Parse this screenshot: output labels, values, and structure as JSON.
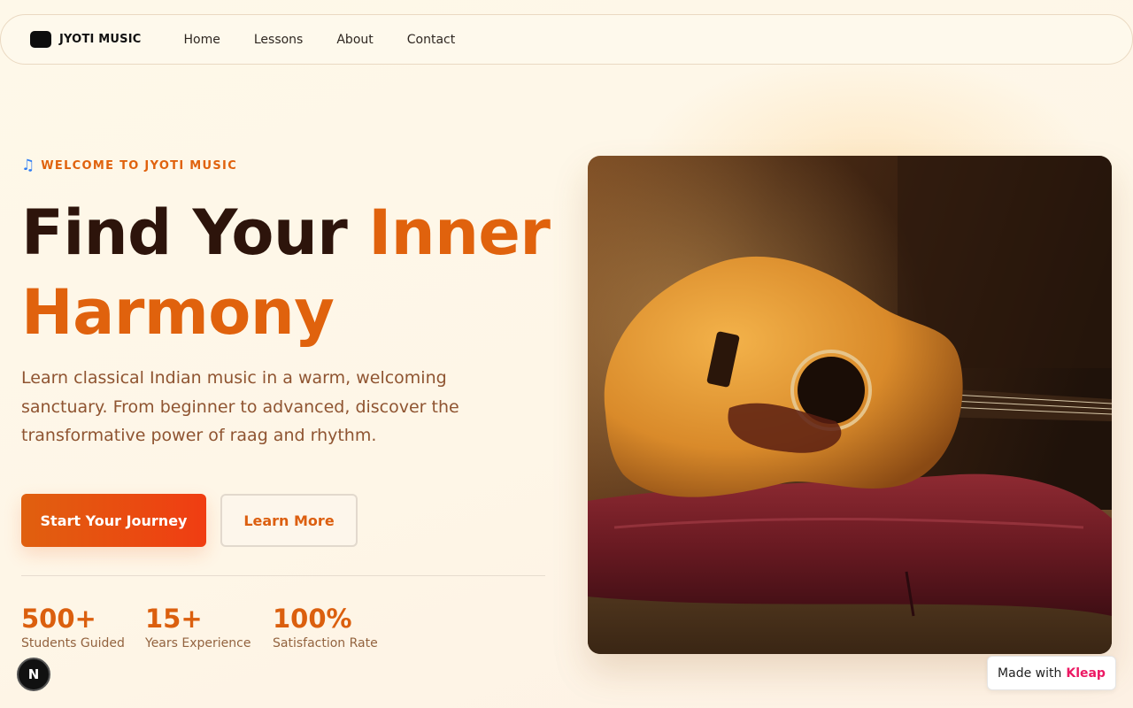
{
  "brand": {
    "name": "JYOTI MUSIC",
    "logo_icon": "logo-square-icon"
  },
  "nav": {
    "links": [
      "Home",
      "Lessons",
      "About",
      "Contact"
    ]
  },
  "hero": {
    "eyebrow_icon": "music-note-icon",
    "eyebrow": "WELCOME TO JYOTI MUSIC",
    "headline_part1": "Find Your ",
    "headline_accent": "Inner Harmony",
    "description": "Learn classical Indian music in a warm, welcoming sanctuary. From beginner to advanced, discover the transformative power of raag and rhythm.",
    "primary_cta": "Start Your Journey",
    "secondary_cta": "Learn More",
    "image_subject": "acoustic guitar resting on velvet cushion"
  },
  "stats": [
    {
      "value": "500+",
      "label": "Students Guided"
    },
    {
      "value": "15+",
      "label": "Years Experience"
    },
    {
      "value": "100%",
      "label": "Satisfaction Rate"
    }
  ],
  "badges": {
    "framework_letter": "N",
    "made_with_prefix": "Made with",
    "made_with_brand": "Kleap"
  },
  "colors": {
    "accent": "#e0620d",
    "heading": "#2d140b",
    "body_text": "#8f5431",
    "background": "#fef7e8",
    "kleap_pink": "#ec1863"
  }
}
